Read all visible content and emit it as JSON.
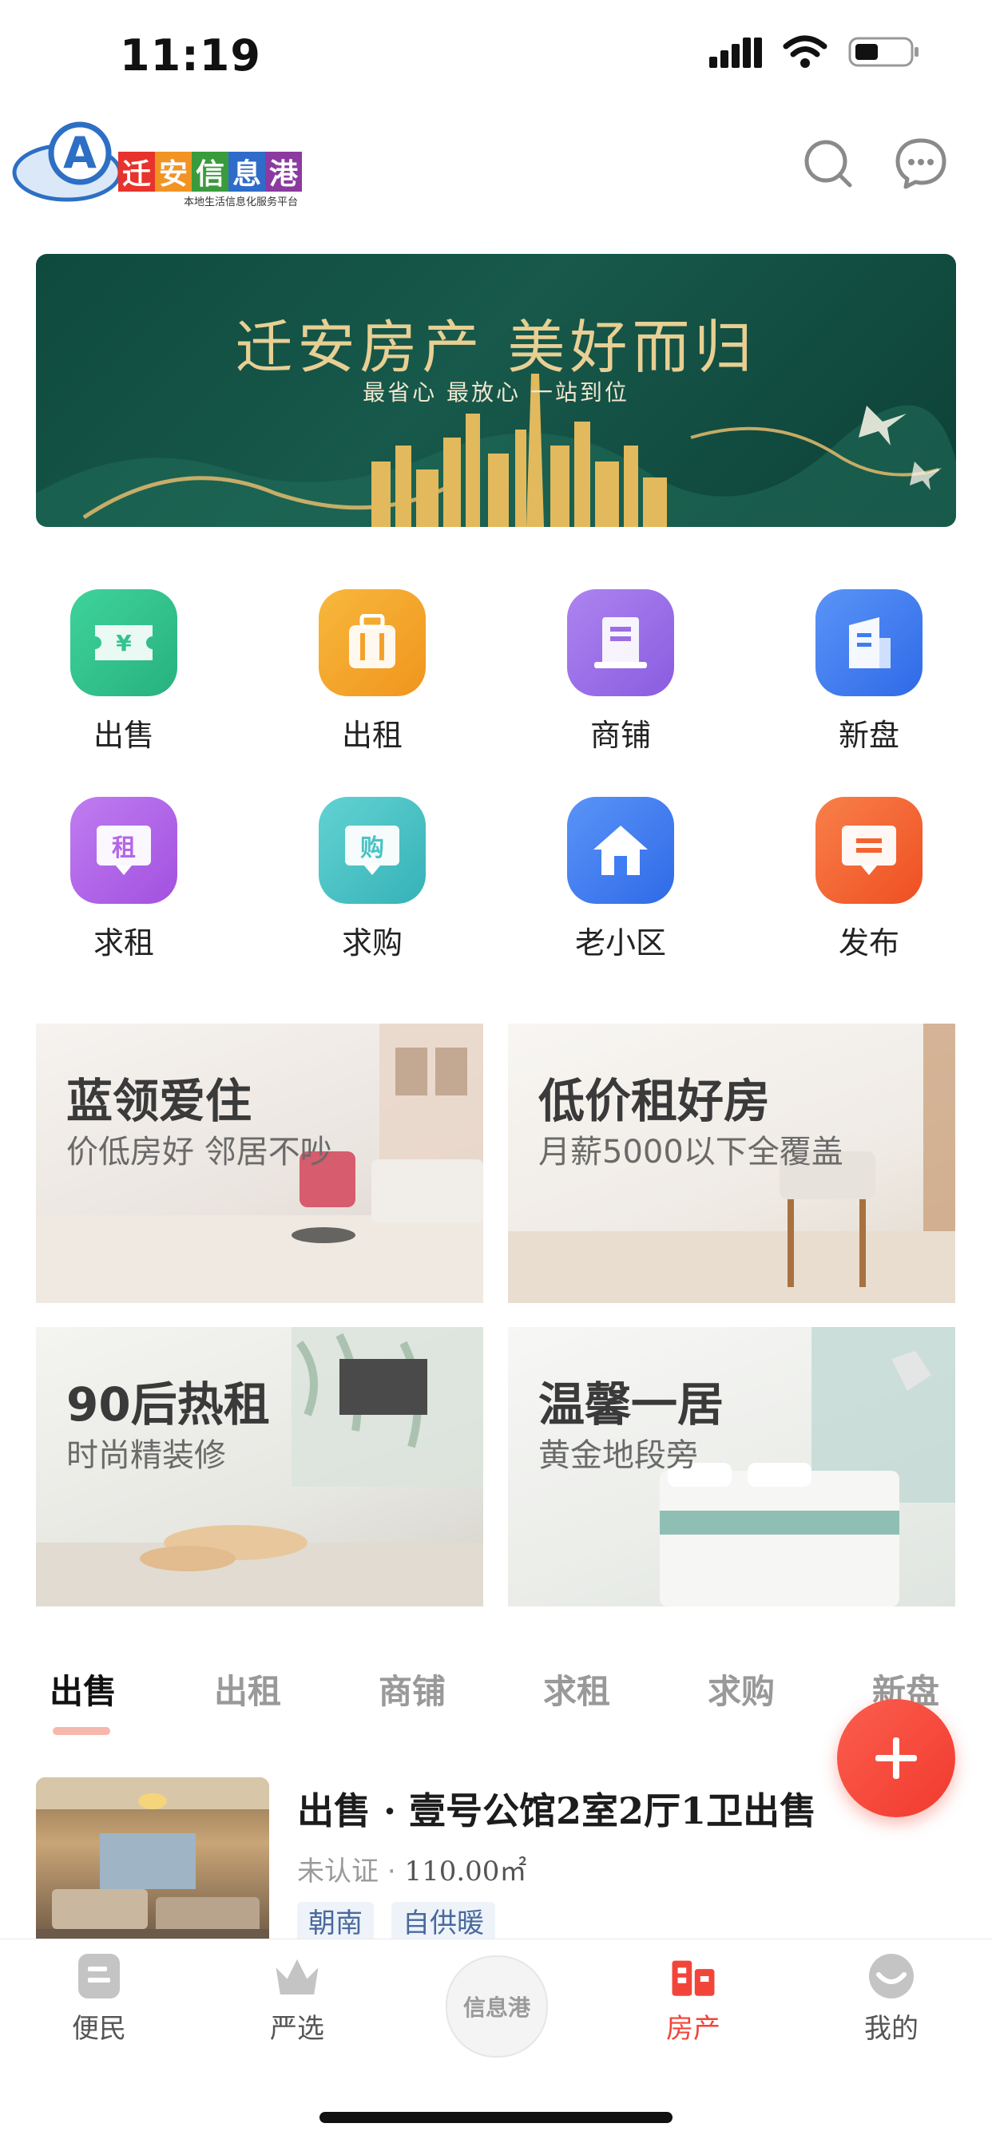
{
  "status_bar": {
    "time": "11:19"
  },
  "header": {
    "logo_chars": [
      "迁",
      "安",
      "信",
      "息",
      "港"
    ],
    "logo_colors": [
      "#e7332b",
      "#f29424",
      "#3a9b3d",
      "#2f6cc9",
      "#8b3aa0"
    ],
    "logo_subtitle": "本地生活信息化服务平台",
    "search_icon": "search-icon",
    "message_icon": "chat-bubble-icon"
  },
  "banner": {
    "title": "迁安房产  美好而归",
    "subtitle": "最省心  最放心   一站到位"
  },
  "categories": [
    {
      "label": "出售",
      "icon": "yuan-ticket-icon",
      "color": "#34c28f"
    },
    {
      "label": "出租",
      "icon": "suitcase-icon",
      "color": "#f3a12a"
    },
    {
      "label": "商铺",
      "icon": "shop-building-icon",
      "color": "#9b6ee6"
    },
    {
      "label": "新盘",
      "icon": "new-building-icon",
      "color": "#3e7df3"
    },
    {
      "label": "求租",
      "icon": "rent-badge-icon",
      "color": "#b565e8"
    },
    {
      "label": "求购",
      "icon": "buy-badge-icon",
      "color": "#4bc3c6"
    },
    {
      "label": "老小区",
      "icon": "house-icon",
      "color": "#3e7df3"
    },
    {
      "label": "发布",
      "icon": "publish-note-icon",
      "color": "#f4622f"
    }
  ],
  "promos": [
    {
      "title": "蓝领爱住",
      "subtitle": "价低房好 邻居不吵"
    },
    {
      "title": "低价租好房",
      "subtitle": "月薪5000以下全覆盖"
    },
    {
      "title": "90后热租",
      "subtitle": "时尚精装修"
    },
    {
      "title": "温馨一居",
      "subtitle": "黄金地段旁"
    }
  ],
  "tabs": [
    "出售",
    "出租",
    "商铺",
    "求租",
    "求购",
    "新盘"
  ],
  "listing": {
    "title": "出售 · 壹号公馆2室2厅1卫出售",
    "cert": "未认证",
    "area": "110.00㎡",
    "tags": [
      "朝南",
      "自供暖"
    ]
  },
  "bottom_nav": {
    "items": [
      "便民",
      "严选",
      "房产",
      "我的"
    ],
    "center_label": "信息港"
  },
  "colors": {
    "accent": "#f2453a",
    "brand_green": "#0f4a3e"
  }
}
